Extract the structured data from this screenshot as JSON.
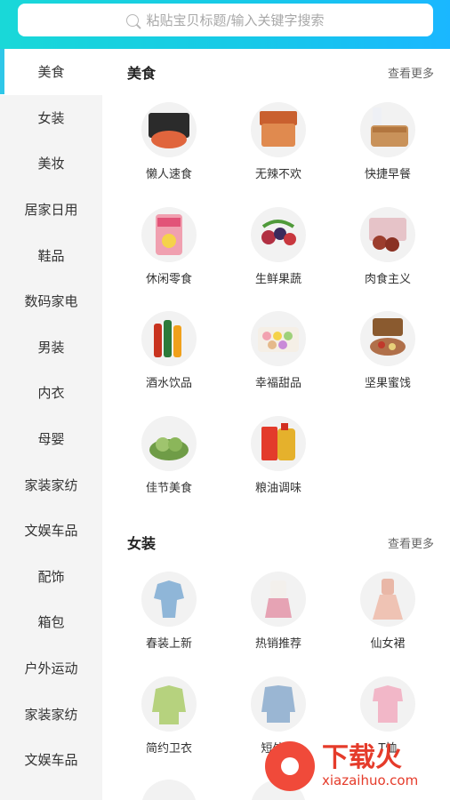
{
  "search": {
    "placeholder": "粘贴宝贝标题/输入关键字搜索"
  },
  "sidebar": {
    "items": [
      {
        "label": "美食"
      },
      {
        "label": "女装"
      },
      {
        "label": "美妆"
      },
      {
        "label": "居家日用"
      },
      {
        "label": "鞋品"
      },
      {
        "label": "数码家电"
      },
      {
        "label": "男装"
      },
      {
        "label": "内衣"
      },
      {
        "label": "母婴"
      },
      {
        "label": "家装家纺"
      },
      {
        "label": "文娱车品"
      },
      {
        "label": "配饰"
      },
      {
        "label": "箱包"
      },
      {
        "label": "户外运动"
      },
      {
        "label": "家装家纺"
      },
      {
        "label": "文娱车品"
      }
    ]
  },
  "sections": [
    {
      "title": "美食",
      "more": "查看更多",
      "items": [
        {
          "label": "懒人速食",
          "color": "#e0653d"
        },
        {
          "label": "无辣不欢",
          "color": "#e08a4f"
        },
        {
          "label": "快捷早餐",
          "color": "#c9925a"
        },
        {
          "label": "休闲零食",
          "color": "#f0a0b0"
        },
        {
          "label": "生鲜果蔬",
          "color": "#b13042"
        },
        {
          "label": "肉食主义",
          "color": "#9c3d2d"
        },
        {
          "label": "酒水饮品",
          "color": "#c8331f"
        },
        {
          "label": "幸福甜品",
          "color": "#e5b98a"
        },
        {
          "label": "坚果蜜饯",
          "color": "#b0704a"
        },
        {
          "label": "佳节美食",
          "color": "#7fae5a"
        },
        {
          "label": "粮油调味",
          "color": "#e5b12c"
        }
      ]
    },
    {
      "title": "女装",
      "more": "查看更多",
      "items": [
        {
          "label": "春装上新",
          "color": "#8fb6d8"
        },
        {
          "label": "热销推荐",
          "color": "#e6a3b4"
        },
        {
          "label": "仙女裙",
          "color": "#e9b7a7"
        },
        {
          "label": "简约卫衣",
          "color": "#b6d27e"
        },
        {
          "label": "短外套",
          "color": "#9ab6d3"
        },
        {
          "label": "T恤",
          "color": "#f2b7c8"
        }
      ]
    }
  ],
  "watermark": {
    "main": "下载火",
    "sub": "xiazaihuo.com"
  }
}
